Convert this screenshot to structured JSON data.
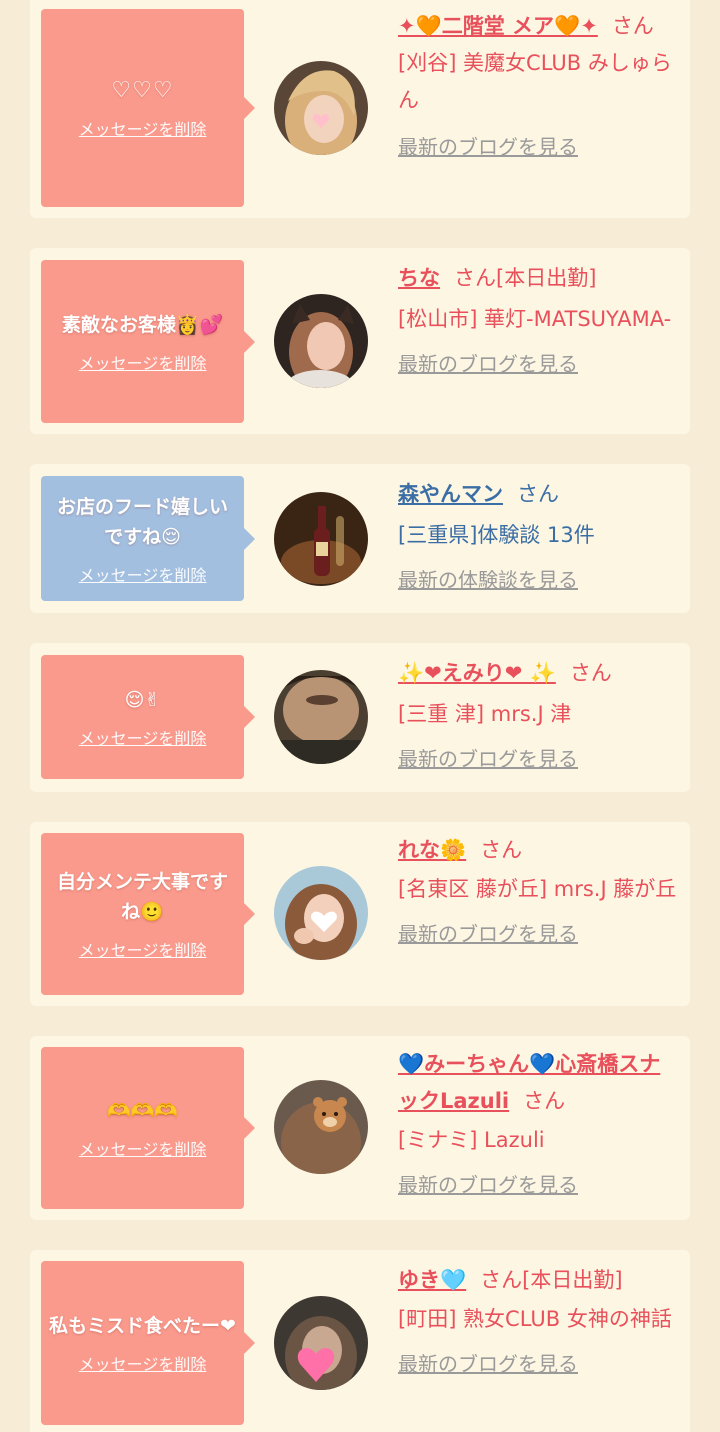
{
  "cards": [
    {
      "message": "♡♡♡",
      "delete_label": "メッセージを削除",
      "name": "✦🧡二階堂 メア🧡✦",
      "suffix": "さん",
      "shop": "[刈谷] 美魔女CLUB みしゅらん",
      "link": "最新のブログを見る",
      "theme": "pink"
    },
    {
      "message": "素敵なお客様👸💕",
      "delete_label": "メッセージを削除",
      "name": "ちな",
      "suffix": "さん[本日出勤]",
      "shop": "[松山市] 華灯-MATSUYAMA-",
      "link": "最新のブログを見る",
      "theme": "pink"
    },
    {
      "message": "お店のフード嬉しいですね😌",
      "delete_label": "メッセージを削除",
      "name": "森やんマン",
      "suffix": "さん",
      "shop": "[三重県]体験談 13件",
      "link": "最新の体験談を見る",
      "theme": "blue"
    },
    {
      "message": "😌✌",
      "delete_label": "メッセージを削除",
      "name": "✨❤えみり❤ ✨",
      "suffix": "さん",
      "shop": "[三重 津] mrs.J 津",
      "link": "最新のブログを見る",
      "theme": "pink"
    },
    {
      "message": "自分メンテ大事ですね🙂",
      "delete_label": "メッセージを削除",
      "name": "れな🌼",
      "suffix": "さん",
      "shop": "[名東区 藤が丘] mrs.J 藤が丘",
      "link": "最新のブログを見る",
      "theme": "pink"
    },
    {
      "message": "🫶🫶🫶",
      "delete_label": "メッセージを削除",
      "name": "💙みーちゃん💙心斎橋スナックLazuli",
      "suffix": "さん",
      "shop": "[ミナミ] Lazuli",
      "link": "最新のブログを見る",
      "theme": "pink"
    },
    {
      "message": "私もミスド食べたー❤",
      "delete_label": "メッセージを削除",
      "name": "ゆき🩵",
      "suffix": "さん[本日出勤]",
      "shop": "[町田] 熟女CLUB 女神の神話",
      "link": "最新のブログを見る",
      "theme": "pink"
    }
  ],
  "colors": {
    "page_bg": "#f7ecd6",
    "card_bg": "#fdf6e3",
    "bubble_pink": "#fa9a8c",
    "bubble_blue": "#a2bfe0",
    "name_pink": "#e8505b",
    "name_blue": "#3b6ea5",
    "link_gray": "#9a9a9a"
  }
}
